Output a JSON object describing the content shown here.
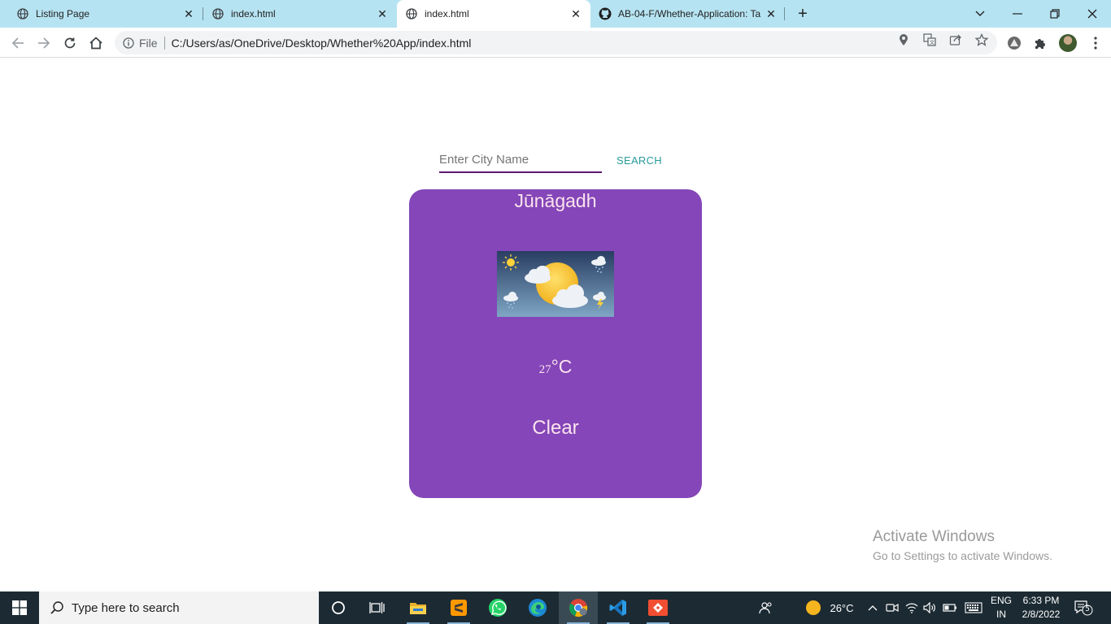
{
  "browser": {
    "tabs": [
      {
        "title": "Listing Page",
        "active": false
      },
      {
        "title": "index.html",
        "active": false
      },
      {
        "title": "index.html",
        "active": true
      },
      {
        "title": "AB-04-F/Whether-Application: Ta",
        "active": false
      }
    ],
    "address": {
      "scheme_label": "File",
      "url": "C:/Users/as/OneDrive/Desktop/Whether%20App/index.html"
    }
  },
  "app": {
    "search": {
      "placeholder": "Enter City Name",
      "value": "",
      "button_label": "SEARCH"
    },
    "weather": {
      "city": "Jūnāgadh",
      "temperature": "27",
      "unit": "°C",
      "description": "Clear"
    }
  },
  "watermark": {
    "line1": "Activate Windows",
    "line2": "Go to Settings to activate Windows."
  },
  "taskbar": {
    "search_placeholder": "Type here to search",
    "weather_temp": "26°C",
    "lang_line1": "ENG",
    "lang_line2": "IN",
    "time": "6:33 PM",
    "date": "2/8/2022",
    "notification_count": "5"
  },
  "colors": {
    "card_bg": "#8446b8",
    "card_text": "#fbe3ee",
    "input_underline": "#5b1a6e",
    "search_button": "#2a9a9a",
    "tabstrip_bg": "#b6e3f1",
    "taskbar_bg": "#1c2a33"
  }
}
